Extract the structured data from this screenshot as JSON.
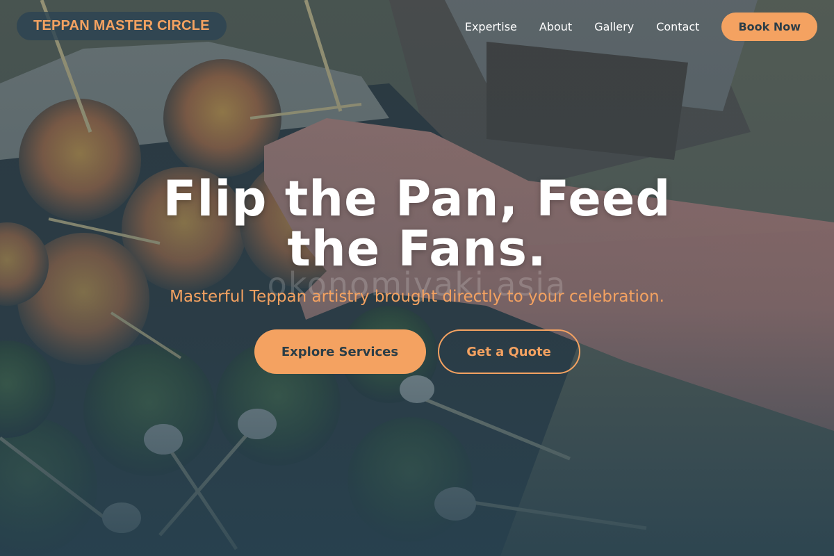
{
  "brand": {
    "name": "TEPPAN MASTER CIRCLE"
  },
  "nav": {
    "links": [
      {
        "label": "Expertise"
      },
      {
        "label": "About"
      },
      {
        "label": "Gallery"
      },
      {
        "label": "Contact"
      }
    ],
    "cta_label": "Book Now"
  },
  "hero": {
    "headline": "Flip the Pan, Feed the Fans.",
    "subtitle": "Masterful Teppan artistry brought directly to your celebration.",
    "primary_cta": "Explore Services",
    "secondary_cta": "Get a Quote",
    "watermark": "okonomiyaki asia"
  },
  "colors": {
    "accent": "#f4a261",
    "dark": "#2c4452",
    "button_text": "#2c3e47"
  },
  "background": {
    "image_description_icon": "food-cups-photo"
  }
}
